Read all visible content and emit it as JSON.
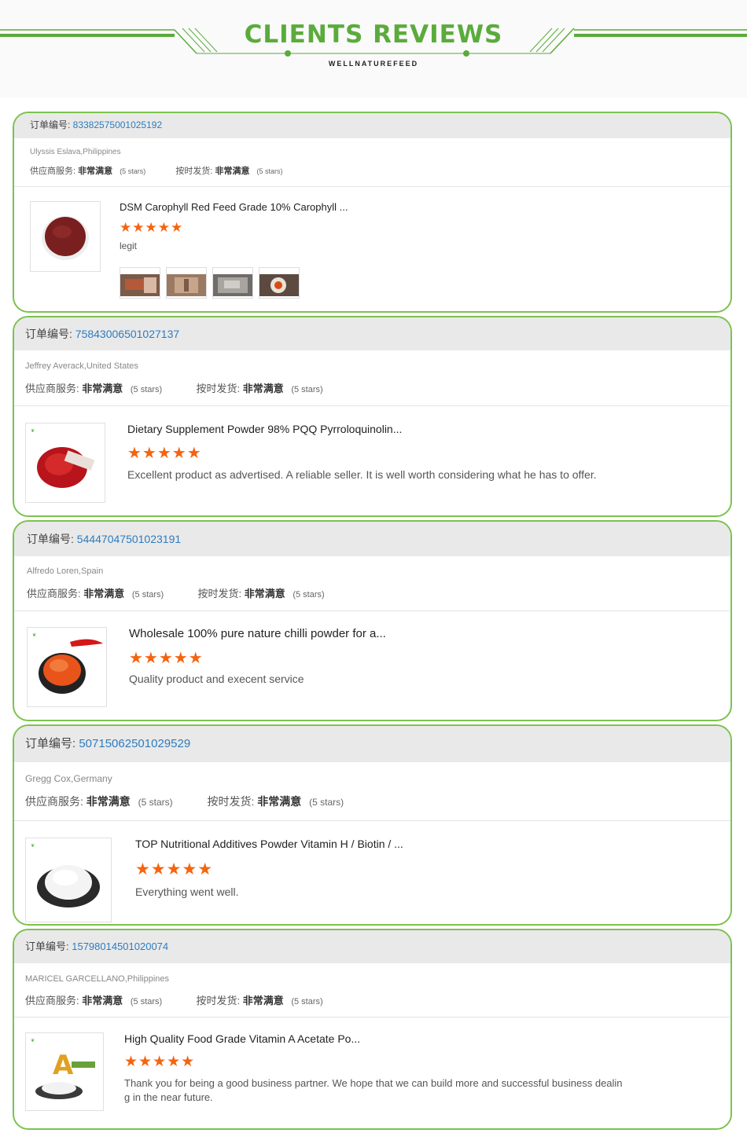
{
  "header": {
    "title": "CLIENTS REVIEWS",
    "subtitle": "WELLNATUREFEED",
    "accent_color": "#5bab3c"
  },
  "labels": {
    "order_no": "订单编号: ",
    "supplier_service": "供应商服务: ",
    "on_time_delivery": "按时发货: ",
    "very_satisfied": "非常满意",
    "stars_text": "(5 stars)"
  },
  "reviews": [
    {
      "order_number": "83382575001025192",
      "customer": "Ulyssis Eslava,Philippines",
      "product_title": "DSM Carophyll Red Feed Grade 10% Carophyll ...",
      "rating": 5,
      "rating_stars": "★★★★★",
      "comment": "legit",
      "photo_icons": [
        "red-powder-photo-icon",
        "bag-photo-icon",
        "bag-photo-icon",
        "liquid-photo-icon"
      ]
    },
    {
      "order_number": "75843006501027137",
      "customer": "Jeffrey Averack,United States",
      "product_title": "Dietary Supplement Powder 98% PQQ Pyrroloquinolin...",
      "rating": 5,
      "rating_stars": "★★★★★",
      "comment": "Excellent product as advertised.  A reliable seller.  It is well worth considering what he has to offer."
    },
    {
      "order_number": "54447047501023191",
      "customer": "Alfredo Loren,Spain",
      "product_title": "Wholesale 100% pure nature chilli powder for a...",
      "rating": 5,
      "rating_stars": "★★★★★",
      "comment": "Quality product and execent service"
    },
    {
      "order_number": "50715062501029529",
      "customer": "Gregg Cox,Germany",
      "product_title": "TOP Nutritional Additives Powder Vitamin H / Biotin / ...",
      "rating": 5,
      "rating_stars": "★★★★★",
      "comment": "Everything went well."
    },
    {
      "order_number": "15798014501020074",
      "customer": "MARICEL GARCELLANO,Philippines",
      "product_title": "High Quality Food Grade Vitamin A Acetate Po...",
      "rating": 5,
      "rating_stars": "★★★★★",
      "comment": "Thank you for being a good business partner. We hope that we can build more and successful business dealing in the near future."
    }
  ],
  "colors": {
    "card_border": "#7cc24f",
    "order_number": "#2d7cc0",
    "star": "#f5640f",
    "header_bar": "#e9e9e9"
  }
}
